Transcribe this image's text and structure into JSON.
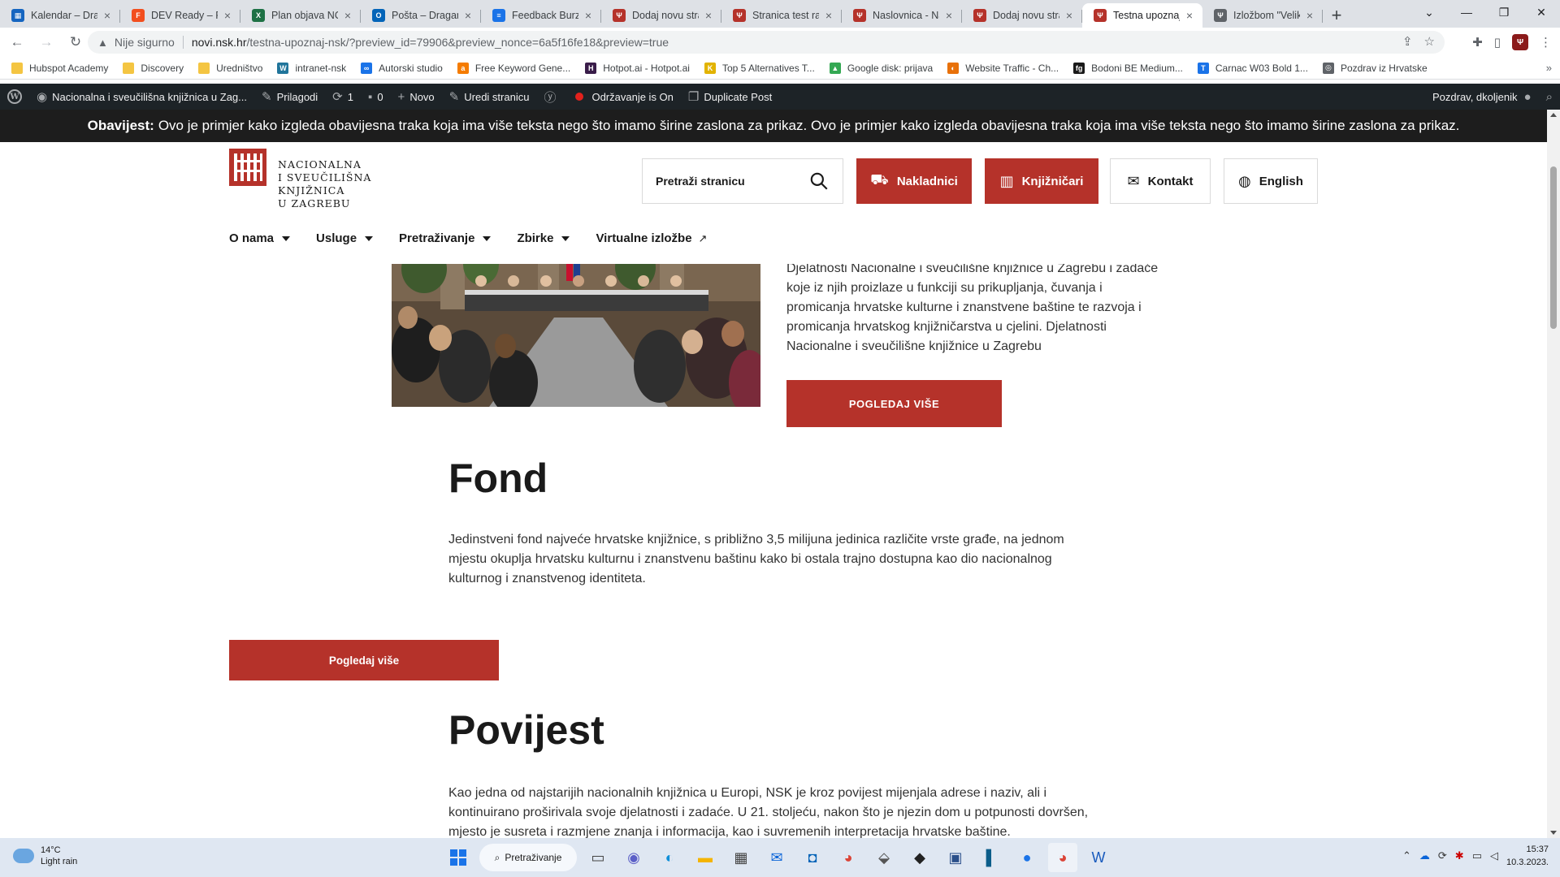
{
  "browser": {
    "tabs": [
      {
        "label": "Kalendar – Drag",
        "color": "#1565c0",
        "glyph": "▦"
      },
      {
        "label": "DEV Ready – Fig",
        "color": "#f24e1e",
        "glyph": "F"
      },
      {
        "label": "Plan objava NO",
        "color": "#1e7145",
        "glyph": "X"
      },
      {
        "label": "Pošta – Dragan",
        "color": "#0364b8",
        "glyph": "O"
      },
      {
        "label": "Feedback Burza",
        "color": "#1a73e8",
        "glyph": "≡"
      },
      {
        "label": "Dodaj novu stra",
        "color": "#b5322a",
        "glyph": "Ψ"
      },
      {
        "label": "Stranica test ra",
        "color": "#b5322a",
        "glyph": "Ψ"
      },
      {
        "label": "Naslovnica - Na",
        "color": "#b5322a",
        "glyph": "Ψ"
      },
      {
        "label": "Dodaj novu stra",
        "color": "#b5322a",
        "glyph": "Ψ"
      },
      {
        "label": "Testna upoznaj",
        "color": "#b5322a",
        "glyph": "Ψ",
        "active": true
      },
      {
        "label": "Izložbom \"Velik",
        "color": "#5f6368",
        "glyph": "Ψ"
      }
    ],
    "new_tab": "+",
    "security_label": "Nije sigurno",
    "url_host": "novi.nsk.hr",
    "url_path": "/testna-upoznaj-nsk/?preview_id=79906&preview_nonce=6a5f16fe18&preview=true",
    "bookmarks": [
      {
        "label": "Hubspot Academy",
        "color": "#f4c542",
        "glyph": ""
      },
      {
        "label": "Discovery",
        "color": "#f4c542",
        "glyph": ""
      },
      {
        "label": "Uredništvo",
        "color": "#f4c542",
        "glyph": ""
      },
      {
        "label": "intranet-nsk",
        "color": "#21759b",
        "glyph": "W"
      },
      {
        "label": "Autorski studio",
        "color": "#1a73e8",
        "glyph": "∞"
      },
      {
        "label": "Free Keyword Gene...",
        "color": "#f57c00",
        "glyph": "a"
      },
      {
        "label": "Hotpot.ai - Hotpot.ai",
        "color": "#3a1d4a",
        "glyph": "H"
      },
      {
        "label": "Top 5 Alternatives T...",
        "color": "#e2b300",
        "glyph": "K"
      },
      {
        "label": "Google disk: prijava",
        "color": "#34a853",
        "glyph": "▲"
      },
      {
        "label": "Website Traffic - Ch...",
        "color": "#e8710a",
        "glyph": "◐"
      },
      {
        "label": "Bodoni BE Medium...",
        "color": "#1a1a1a",
        "glyph": "fg"
      },
      {
        "label": "Carnac W03 Bold 1...",
        "color": "#1a73e8",
        "glyph": "T"
      },
      {
        "label": "Pozdrav iz Hrvatske",
        "color": "#5f6368",
        "glyph": "◎"
      }
    ]
  },
  "wp_admin": {
    "site_name": "Nacionalna i sveučilišna knjižnica u Zag...",
    "customize": "Prilagodi",
    "updates_count": "1",
    "comments_count": "0",
    "new": "Novo",
    "edit_page": "Uredi stranicu",
    "maintenance": "Održavanje is On",
    "duplicate": "Duplicate Post",
    "greeting": "Pozdrav, dkoljenik"
  },
  "notice": {
    "label": "Obavijest:",
    "text": "Ovo je primjer kako izgleda obavijesna traka koja ima više teksta nego što imamo širine zaslona za prikaz. Ovo je primjer kako izgleda obavijesna traka koja ima više teksta nego što imamo širine zaslona za prikaz."
  },
  "site": {
    "logo_lines": [
      "NACIONALNA",
      "I SVEUČILIŠNA",
      "KNJIŽNICA",
      "U ZAGREBU"
    ],
    "search_placeholder": "Pretraži stranicu",
    "btn_publishers": "Nakladnici",
    "btn_librarians": "Knjižničari",
    "btn_contact": "Kontakt",
    "btn_english": "English",
    "nav": [
      {
        "label": "O nama",
        "dropdown": true
      },
      {
        "label": "Usluge",
        "dropdown": true
      },
      {
        "label": "Pretraživanje",
        "dropdown": true
      },
      {
        "label": "Zbirke",
        "dropdown": true
      },
      {
        "label": "Virtualne izložbe",
        "external": true
      }
    ]
  },
  "content": {
    "intro_text": "Djelatnosti Nacionalne i sveučilišne knjižnice u Zagrebu i zadaće koje iz njih proizlaze u funkciji su prikupljanja, čuvanja i promicanja hrvatske kulturne i znanstvene baštine te razvoja i promicanja hrvatskog knjižničarstva u cjelini. Djelatnosti Nacionalne i sveučilišne knjižnice u Zagrebu",
    "btn_more_1": "POGLEDAJ VIŠE",
    "fond_heading": "Fond",
    "fond_text": "Jedinstveni fond najveće hrvatske knjižnice, s približno 3,5 milijuna jedinica različite vrste građe, na jednom mjestu okuplja hrvatsku kulturnu i znanstvenu baštinu kako bi ostala trajno dostupna kao dio nacionalnog kulturnog i znanstvenog identiteta.",
    "btn_more_2": "Pogledaj više",
    "history_heading": "Povijest",
    "history_text": "Kao jedna od najstarijih nacionalnih knjižnica u Europi, NSK je kroz povijest mijenjala adrese i naziv, ali i kontinuirano proširivala svoje djelatnosti i zadaće. U 21. stoljeću, nakon što je njezin dom u potpunosti dovršen, mjesto je susreta i razmjene znanja i informacija, kao i suvremenih interpretacija hrvatske baštine."
  },
  "taskbar": {
    "temp": "14°C",
    "weather": "Light rain",
    "search": "Pretraživanje",
    "time": "15:37",
    "date": "10.3.2023."
  }
}
